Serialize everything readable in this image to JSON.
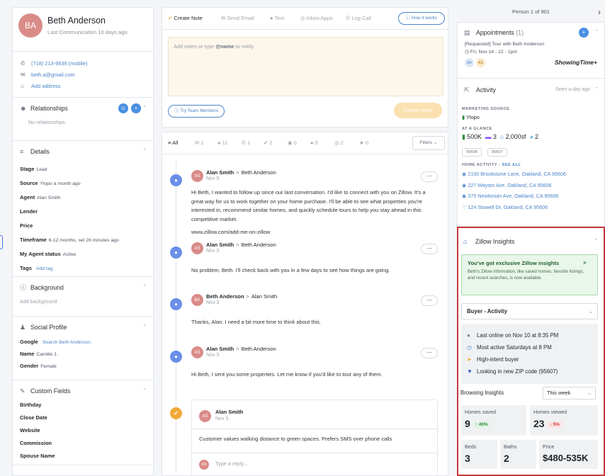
{
  "contact": {
    "initials": "BA",
    "name": "Beth Anderson",
    "last_comm": "Last Communication 10 days ago",
    "phone": "(718) 213-9939",
    "phone_type": "(mobile)",
    "email": "beth.a@gmail.com",
    "add_address": "Add address"
  },
  "relationships": {
    "title": "Relationships",
    "empty": "No relationships"
  },
  "details": {
    "title": "Details",
    "fields": [
      {
        "label": "Stage",
        "value": "Lead"
      },
      {
        "label": "Source",
        "value": "Ylopo a month ago"
      },
      {
        "label": "Agent",
        "value": "Alan Smith"
      },
      {
        "label": "Lender",
        "value": ""
      },
      {
        "label": "Price",
        "value": ""
      },
      {
        "label": "Timeframe",
        "value": "6-12 months, set 28 minutes ago"
      },
      {
        "label": "My Agent status",
        "value": "Active"
      }
    ],
    "tags_label": "Tags",
    "add_tag": "Add tag"
  },
  "background": {
    "title": "Background",
    "add": "Add background"
  },
  "social": {
    "title": "Social Profile",
    "fields": [
      {
        "label": "Google",
        "value": "Search Beth Anderson"
      },
      {
        "label": "Name",
        "value": "Camille J."
      },
      {
        "label": "Gender",
        "value": "Female"
      }
    ]
  },
  "custom": {
    "title": "Custom Fields",
    "fields": [
      "Birthday",
      "Close Date",
      "Website",
      "Commission",
      "Spouse Name"
    ]
  },
  "composer": {
    "tabs": [
      "Create Note",
      "Send Email",
      "Text",
      "Inbox Apps",
      "Log Call"
    ],
    "how_it_works": "How it works",
    "placeholder_pre": "Add notes or type ",
    "placeholder_tag": "@name",
    "placeholder_post": " to notify",
    "team_mentions": "Try Team Mentions",
    "create_button": "Create Note"
  },
  "feed_tabs": {
    "all": "All",
    "counts": [
      "1",
      "11",
      "1",
      "2",
      "0",
      "0",
      "2",
      "0"
    ],
    "filters": "Filters"
  },
  "entries": [
    {
      "initials": "AS",
      "from": "Alan Smith",
      "to": "Beth Anderson",
      "date": "Nov 9",
      "text": "Hi Beth, I wanted to follow up since our last conversation. I'd like to connect with you on Zillow. It's a great way for us to work together on your home purchase. I'll be able to see what properties you're interested in, recommend similar homes, and quickly schedule tours to help you stay ahead in this competitive market.",
      "link": "www.zillow.com/add-me-on-zillow"
    },
    {
      "initials": "AS",
      "from": "Alan Smith",
      "to": "Beth Anderson",
      "date": "Nov 3",
      "text": "No problem, Beth. I'll check back with you in a few days to see how things are going."
    },
    {
      "initials": "BA",
      "from": "Beth Anderson",
      "to": "Alan Smith",
      "date": "Nov 3",
      "text": "Thanks, Alan. I need a bit more time to think about this."
    },
    {
      "initials": "AS",
      "from": "Alan Smith",
      "to": "Beth Anderson",
      "date": "Nov 3",
      "text": "Hi Beth, I sent you some properties. Let me know if you'd like to tour any of them."
    }
  ],
  "note": {
    "initials": "AS",
    "from": "Alan Smith",
    "date": "Nov 3",
    "text": "Customer values walking distance to green spaces. Prefers SMS over phone calls",
    "reply_initials": "AS",
    "reply_placeholder": "Type a reply..."
  },
  "pager": "Person 1 of 901",
  "appointments": {
    "title": "Appointments",
    "count": "(1)",
    "item_title": "[Requested] Tour with Beth Anderson",
    "item_time": "Fri, Nov 14 - 12 - 1pm",
    "attendees": [
      "BA",
      "AS"
    ],
    "brand": "ShowingTime+"
  },
  "activity": {
    "title": "Activity",
    "seen": "Seen a day ago",
    "marketing_label": "MARKETING SOURCE",
    "source": "Ylopo",
    "glance_label": "AT A GLANCE",
    "price": "500K",
    "beds": "3",
    "sqft": "2,000sf",
    "baths": "2",
    "zips": [
      "95606",
      "95607"
    ],
    "home_activity_label": "HOME ACTIVITY",
    "see_all": "SEE ALL",
    "addresses": [
      "2150 Brookstone Lane, Oakland, CA 95606",
      "227 Wayton Ave, Oakland, CA 95606",
      "375 Newtonian Ave, Oakland, CA 95606",
      "124 Stowell Dr, Oakland, CA 95606"
    ]
  },
  "zillow": {
    "title": "Zillow Insights",
    "banner_title": "You've got exclusive Zillow insights",
    "banner_text": "Beth's Zillow information, like saved homes, favorite listings, and recent searches, is now available.",
    "select": "Buyer - Activity",
    "items": [
      {
        "icon": "status-dot-icon",
        "text": "Last online on Nov 10 at 8:35 PM",
        "color": "#7d848c"
      },
      {
        "icon": "clock-icon",
        "text": "Most active Saturdays at 8 PM",
        "color": "#4a84c8"
      },
      {
        "icon": "bolt-icon",
        "text": "High-intent buyer",
        "color": "#f2a93b"
      },
      {
        "icon": "location-pin-icon",
        "text": "Looking in new ZIP code (95607)",
        "color": "#2d55c8"
      }
    ],
    "browsing_label": "Browsing Insights",
    "period": "This week",
    "homes_saved_label": "Homes saved",
    "homes_saved": "9",
    "homes_saved_delta": "40%",
    "homes_viewed_label": "Homes viewed",
    "homes_viewed": "23",
    "homes_viewed_delta": "5%",
    "beds_label": "Beds",
    "beds": "3",
    "baths_label": "Baths",
    "baths": "2",
    "price_label": "Price",
    "price": "$480-535K"
  },
  "colors": {
    "accent": "#4a84c8",
    "avatar": "#d98b87",
    "create": "#fbe1b0",
    "zillow_border": "#c8383b",
    "up": "#2e8b3d",
    "down": "#d23b3b"
  }
}
